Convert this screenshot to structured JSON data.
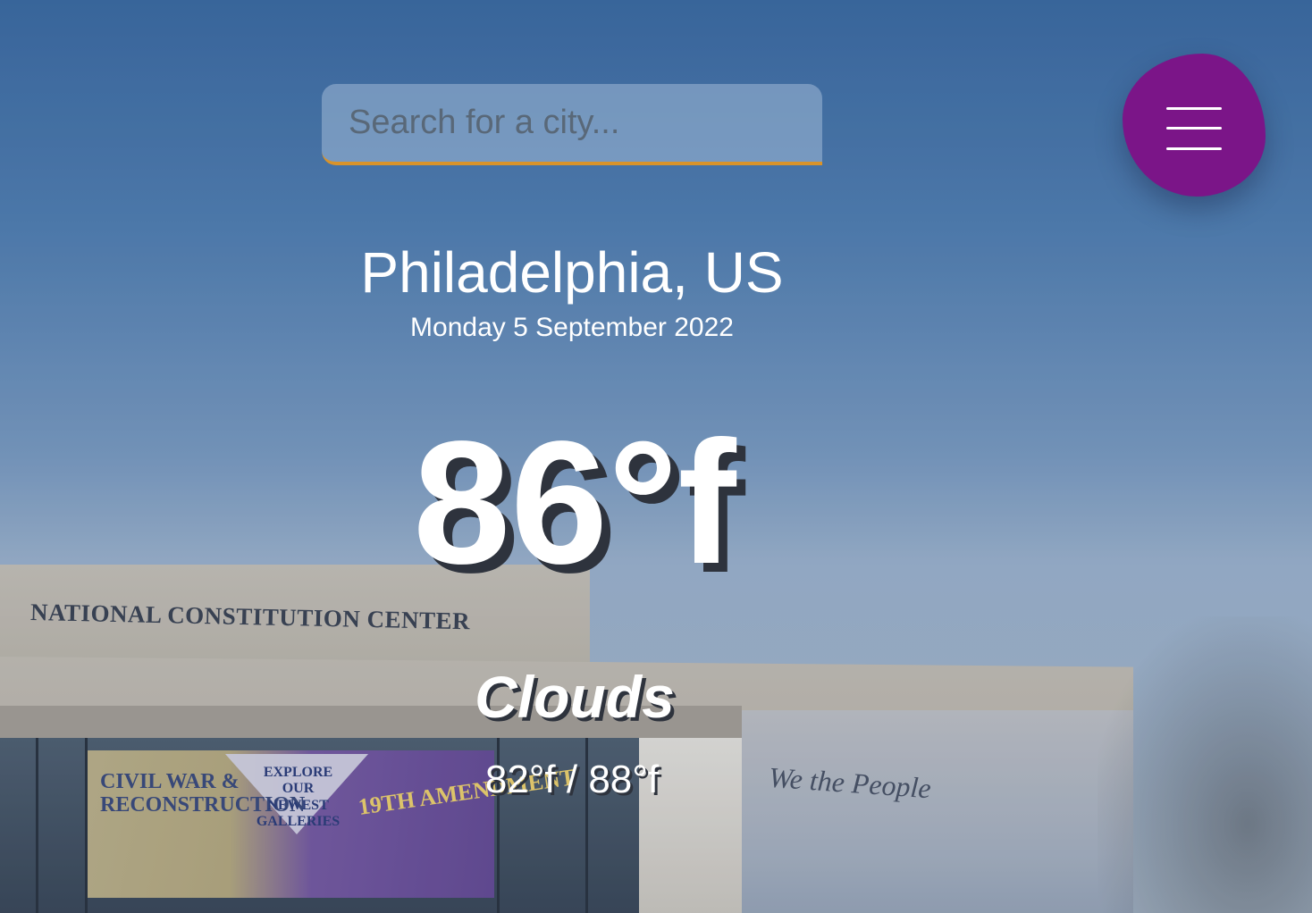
{
  "search": {
    "placeholder": "Search for a city..."
  },
  "menu": {
    "icon": "hamburger-icon"
  },
  "weather": {
    "city": "Philadelphia, US",
    "date": "Monday 5 September 2022",
    "temperature": "86°f",
    "condition": "Clouds",
    "hi_low": "82°f / 88°f"
  },
  "background": {
    "sign": "NATIONAL CONSTITUTION CENTER",
    "banner_left": "CIVIL WAR & RECONSTRUCTION",
    "banner_mid": "EXPLORE OUR NEWEST GALLERIES",
    "banner_right": "19TH AMENDMENT",
    "wall_text": "We the People"
  },
  "colors": {
    "menu_bg": "#7b1588",
    "search_underline": "#d9932a",
    "text": "#ffffff",
    "text_shadow": "#2e333d"
  }
}
